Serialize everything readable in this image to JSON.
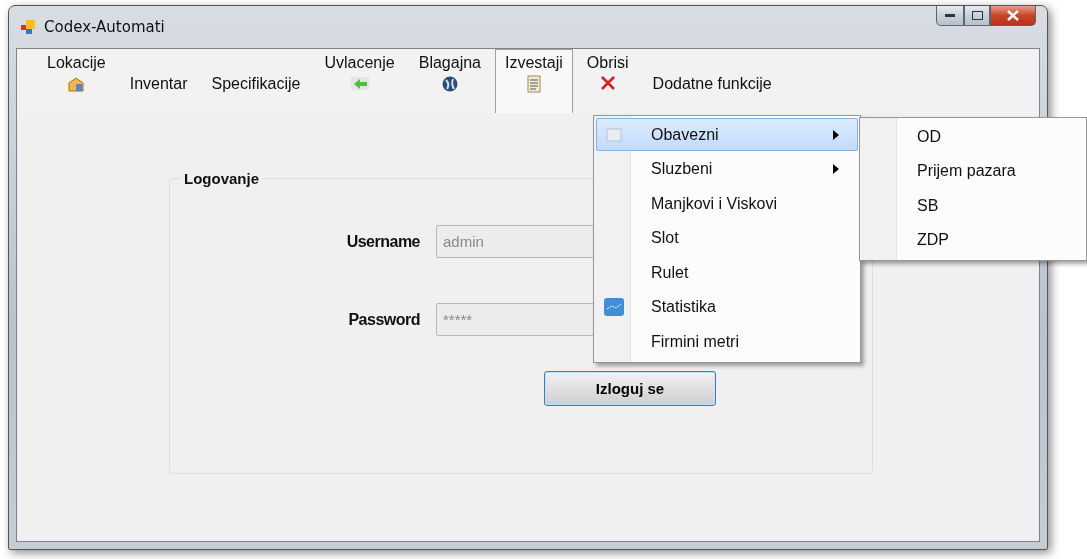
{
  "window": {
    "title": "Codex-Automati"
  },
  "menu": [
    {
      "label": "Lokacije",
      "kind": "house",
      "selected": false
    },
    {
      "label": "Inventar",
      "kind": "plain",
      "selected": false
    },
    {
      "label": "Specifikacije",
      "kind": "plain",
      "selected": false
    },
    {
      "label": "Uvlacenje",
      "kind": "arrow",
      "selected": false
    },
    {
      "label": "Blagajna",
      "kind": "globe",
      "selected": false
    },
    {
      "label": "Izvestaji",
      "kind": "report",
      "selected": true
    },
    {
      "label": "Obrisi",
      "kind": "cross",
      "selected": false
    },
    {
      "label": "Dodatne funkcije",
      "kind": "plain",
      "selected": false
    }
  ],
  "dropdown": [
    {
      "label": "Obavezni",
      "kind": "sheet",
      "submenu": true,
      "selected": true
    },
    {
      "label": "Sluzbeni",
      "kind": "plain",
      "submenu": true,
      "selected": false
    },
    {
      "label": "Manjkovi i Viskovi",
      "kind": "plain",
      "submenu": false,
      "selected": false
    },
    {
      "label": "Slot",
      "kind": "plain",
      "submenu": false,
      "selected": false
    },
    {
      "label": "Rulet",
      "kind": "plain",
      "submenu": false,
      "selected": false
    },
    {
      "label": "Statistika",
      "kind": "chart",
      "submenu": false,
      "selected": false
    },
    {
      "label": "Firmini metri",
      "kind": "plain",
      "submenu": false,
      "selected": false
    }
  ],
  "submenu": [
    {
      "label": "OD"
    },
    {
      "label": "Prijem pazara"
    },
    {
      "label": "SB"
    },
    {
      "label": "ZDP"
    }
  ],
  "login": {
    "title": "Logovanje",
    "fields": [
      {
        "label": "Username",
        "value": "admin",
        "disabled": true
      },
      {
        "label": "Password",
        "value": "*****",
        "disabled": true
      }
    ],
    "button": "Izloguj se"
  }
}
